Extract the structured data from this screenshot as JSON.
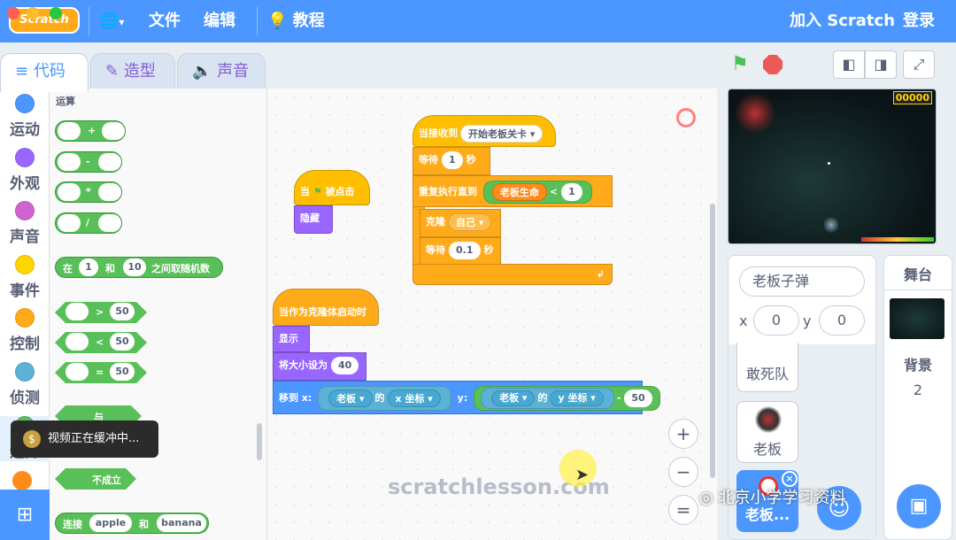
{
  "menubar": {
    "logo": "Scratch",
    "file": "文件",
    "edit": "编辑",
    "tutorials": "教程",
    "join": "加入 Scratch",
    "signin": "登录"
  },
  "tabs": {
    "code": "代码",
    "costumes": "造型",
    "sounds": "声音"
  },
  "categories": [
    {
      "label": "运动",
      "color": "#4c97ff"
    },
    {
      "label": "外观",
      "color": "#9966ff"
    },
    {
      "label": "声音",
      "color": "#cf63cf"
    },
    {
      "label": "事件",
      "color": "#ffd500"
    },
    {
      "label": "控制",
      "color": "#ffab19"
    },
    {
      "label": "侦测",
      "color": "#5cb1d6"
    },
    {
      "label": "运算",
      "color": "#59c059"
    }
  ],
  "palette": {
    "heading": "运算",
    "plus": "+",
    "minus": "-",
    "times": "*",
    "divide": "/",
    "random": {
      "pre": "在",
      "a": "1",
      "mid": "和",
      "b": "10",
      "post": "之间取随机数"
    },
    "gt": {
      "op": ">",
      "val": "50"
    },
    "lt": {
      "op": "<",
      "val": "50"
    },
    "eq": {
      "op": "=",
      "val": "50"
    },
    "and": "与",
    "not": "不成立",
    "join": {
      "pre": "连接",
      "a": "apple",
      "mid": "和",
      "b": "banana"
    }
  },
  "scripts": {
    "receive": {
      "label": "当接收到",
      "message": "开始老板关卡"
    },
    "wait1": {
      "label": "等待",
      "value": "1",
      "unit": "秒"
    },
    "repeat": {
      "label": "重复执行直到",
      "var": "老板生命",
      "op": "<",
      "value": "1"
    },
    "clone": {
      "label": "克隆",
      "target": "自己"
    },
    "wait2": {
      "label": "等待",
      "value": "0.1",
      "unit": "秒"
    },
    "flag": {
      "pre": "当",
      "post": "被点击"
    },
    "hide": "隐藏",
    "cloneStart": "当作为克隆体启动时",
    "show": "显示",
    "size": {
      "label": "将大小设为",
      "value": "40"
    },
    "goto": {
      "label": "移到 x:",
      "sprite1": "老板",
      "of1": "的",
      "prop1": "x 坐标",
      "ylabel": "y:",
      "sprite2": "老板",
      "of2": "的",
      "prop2": "y 坐标",
      "minus": "-",
      "value": "50"
    }
  },
  "watermark": "scratchlesson.com",
  "zoom": {
    "in": "+",
    "out": "−",
    "reset": "="
  },
  "stage": {
    "score": "00000"
  },
  "sprite": {
    "name": "老板子弹",
    "x_label": "x",
    "x": "0",
    "y_label": "y",
    "y": "0"
  },
  "sprites": [
    {
      "label": "敢死队"
    },
    {
      "label": "老板"
    },
    {
      "label": "老板..."
    }
  ],
  "backdrop": {
    "title": "舞台",
    "label": "背景",
    "count": "2"
  },
  "toast": "视频正在缓冲中...",
  "overlay": "北京小学学习资料"
}
